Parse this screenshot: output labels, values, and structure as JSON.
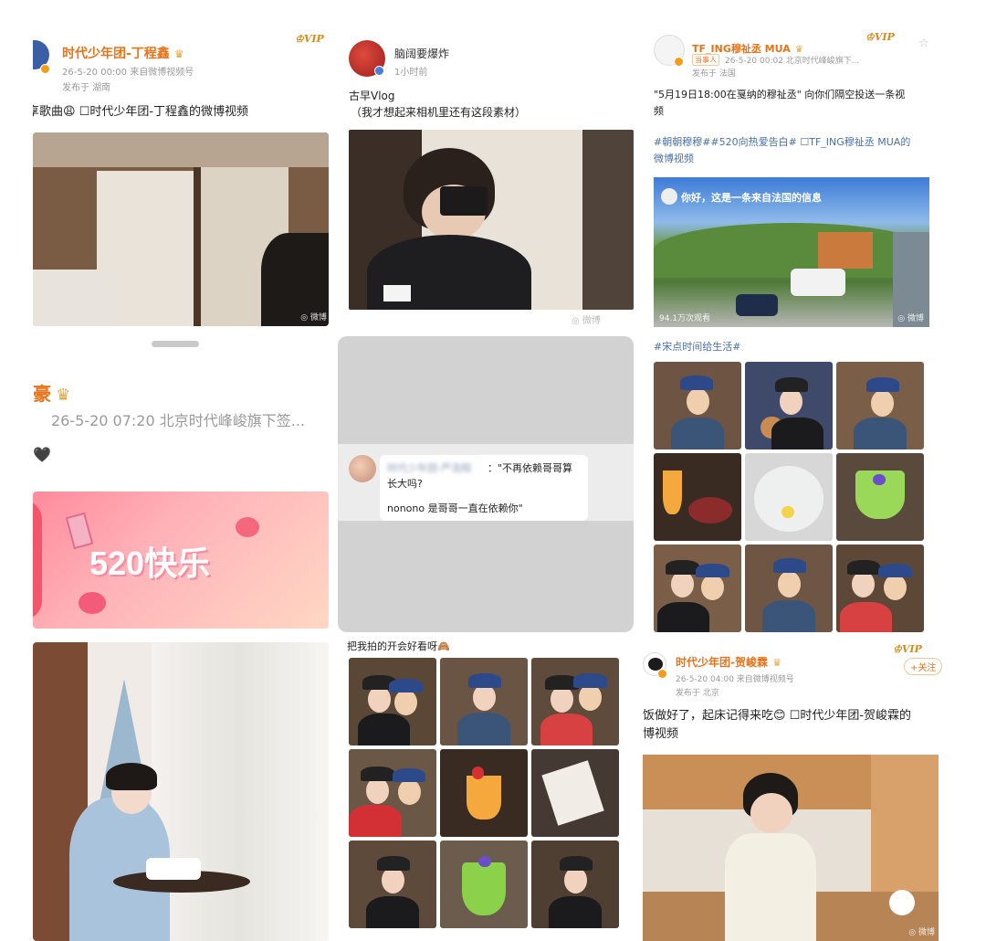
{
  "col1": {
    "post1": {
      "author": "时代少年团-丁程鑫",
      "time_source": "26-5-20 00:00  来自微博视频号",
      "location": "发布于 湖南",
      "text": "享歌曲😩 ☐时代少年团-丁程鑫的微博视频",
      "watermark": "◎ 微博"
    },
    "post2": {
      "author": "豪",
      "time_source": "26-5-20 07:20  北京时代峰峻旗下签...",
      "text": "🖤",
      "banner_text": "520快乐"
    }
  },
  "col2": {
    "post1": {
      "author": "脑阔要爆炸",
      "time": "1小时前",
      "text_line1": "古早Vlog",
      "text_line2": "（我才想起来相机里还有这段素材）"
    },
    "quote": {
      "author_blur": "时代少年团-严浩翔",
      "line1": "：\"不再依赖哥哥算",
      "line2": "长大吗?",
      "line3": "nonono 是哥哥一直在依赖你\""
    },
    "post3": {
      "text": "把我拍的开会好看呀🙈"
    }
  },
  "col3": {
    "post1": {
      "author": "TF_ING穆祉丞 MUA",
      "time_source": "26-5-20 00:02  北京时代峰峻旗下...",
      "chip": "当事人",
      "location": "发布于 法国",
      "text_line1": "\"5月19日18:00在戛纳的穆祉丞\" 向你们隔空投送一条视",
      "text_line2": "频",
      "tags_line1": "#朝朝穆穆##520向热爱告白# ☐TF_ING穆祉丞 MUA的",
      "tags_line2": "微博视频",
      "video_caption": "你好，这是一条来自法国的信息",
      "video_views": "94.1万次观看"
    },
    "post2": {
      "tag": "#宋点时间给生活#"
    },
    "post3": {
      "author": "时代少年团-贺峻霖",
      "time_source": "26-5-20 04:00  来自微博视频号",
      "location": "发布于 北京",
      "follow": "+关注",
      "text_line1": "饭做好了，起床记得来吃😊 ☐时代少年团-贺峻霖的",
      "text_line2": "博视频"
    }
  },
  "icons": {
    "vip_badge": "vip-crown-badge",
    "verified": "verified-badge"
  }
}
